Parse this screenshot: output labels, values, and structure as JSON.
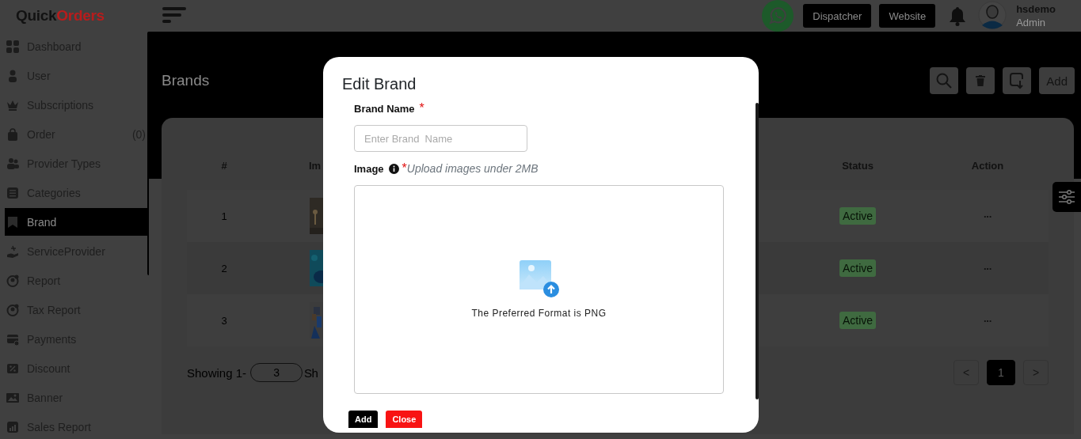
{
  "header": {
    "logo": {
      "part_1": "Quick",
      "part_2": "Orders"
    },
    "buttons": [
      "Dispatcher",
      "Website"
    ],
    "user": {
      "name": "hsdemo",
      "role": "Admin"
    }
  },
  "sidebar": {
    "items": [
      {
        "label": "Dashboard",
        "selected": false
      },
      {
        "label": "User",
        "selected": false
      },
      {
        "label": "Subscriptions",
        "selected": false
      },
      {
        "label": "Order",
        "count": "(0)",
        "selected": false
      },
      {
        "label": "Provider Types",
        "selected": false
      },
      {
        "label": "Categories",
        "selected": false
      },
      {
        "label": "Brand",
        "selected": true
      },
      {
        "label": "ServiceProvider",
        "selected": false
      },
      {
        "label": "Report",
        "selected": false
      },
      {
        "label": "Tax Report",
        "selected": false
      },
      {
        "label": "Payments",
        "selected": false
      },
      {
        "label": "Discount",
        "selected": false
      },
      {
        "label": "Banner",
        "selected": false
      },
      {
        "label": "Sales Report",
        "selected": false
      }
    ]
  },
  "page": {
    "title": "Brands",
    "add_button": "Add"
  },
  "table": {
    "columns": [
      "#",
      "Im",
      "Status",
      "Action"
    ],
    "rows": [
      {
        "number": "1",
        "status": "Active",
        "action": "···"
      },
      {
        "number": "2",
        "status": "Active",
        "action": "···"
      },
      {
        "number": "3",
        "status": "Active",
        "action": "···"
      }
    ]
  },
  "footer": {
    "showing": "Showing 1-",
    "page_size": "3",
    "after": "Sh"
  },
  "pagination": {
    "prev": "<",
    "pages": [
      {
        "label": "1",
        "selected": true
      }
    ],
    "next": ">"
  },
  "modal": {
    "title": "Edit Brand",
    "brand_name": {
      "label": "Brand Name",
      "required_mark": "*",
      "placeholder": "Enter Brand  Name"
    },
    "image": {
      "label": "Image",
      "required_mark": "*",
      "hint": "Upload images under 2MB",
      "upload_text": "The Preferred Format is PNG"
    },
    "buttons": [
      {
        "label": "Add",
        "kind": "primary"
      },
      {
        "label": "Close",
        "kind": "danger"
      }
    ]
  }
}
